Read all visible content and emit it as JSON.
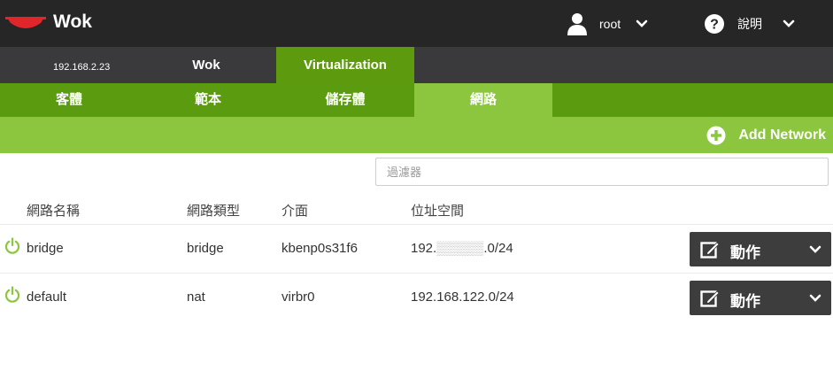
{
  "header": {
    "brand": "Wok",
    "user": "root",
    "help": "說明"
  },
  "hostbar": {
    "ip": "192.168.2.23",
    "tabs": [
      "Wok",
      "Virtualization"
    ]
  },
  "subnav": {
    "tabs": [
      "客體",
      "範本",
      "儲存體",
      "網路"
    ],
    "active": "網路"
  },
  "actionbar": {
    "add_network": "Add Network"
  },
  "filter": {
    "placeholder": "過濾器",
    "value": ""
  },
  "table": {
    "headers": [
      "網路名稱",
      "網路類型",
      "介面",
      "位址空間"
    ],
    "rows": [
      {
        "name": "bridge",
        "type": "bridge",
        "interface": "kbenp0s31f6",
        "addr_prefix": "192.",
        "addr_mask": "▒▒▒▒▒",
        "addr_suffix": ".0/24",
        "action": "動作"
      },
      {
        "name": "default",
        "type": "nat",
        "interface": "virbr0",
        "addr_prefix": "192.168.122.0/24",
        "addr_mask": "",
        "addr_suffix": "",
        "action": "動作"
      }
    ]
  },
  "colors": {
    "topbar": "#262626",
    "hostbar": "#3a3a3c",
    "green_dark": "#5b9b10",
    "green_light": "#8cc63f",
    "wok_red": "#e0262b"
  }
}
